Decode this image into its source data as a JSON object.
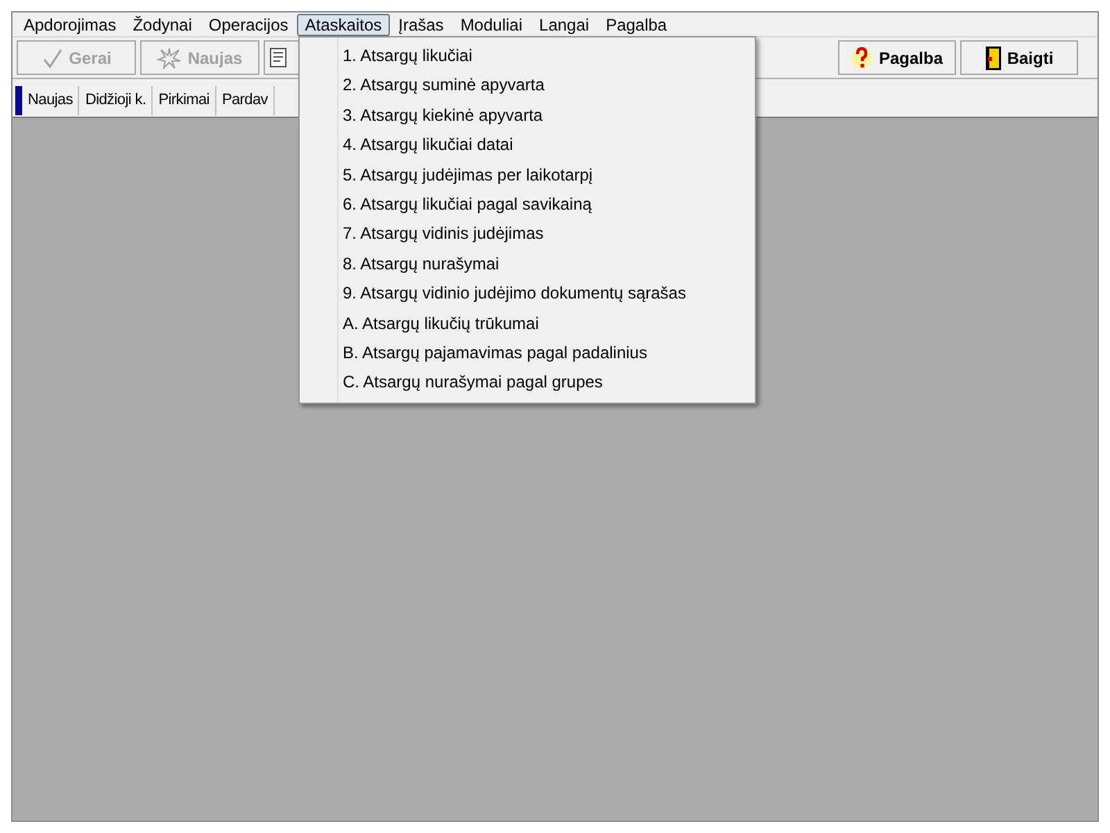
{
  "menu_bar": [
    {
      "label": "Apdorojimas",
      "selected": false
    },
    {
      "label": "Žodynai",
      "selected": false
    },
    {
      "label": "Operacijos",
      "selected": false
    },
    {
      "label": "Ataskaitos",
      "selected": true
    },
    {
      "label": "Įrašas",
      "selected": false
    },
    {
      "label": "Moduliai",
      "selected": false
    },
    {
      "label": "Langai",
      "selected": false
    },
    {
      "label": "Pagalba",
      "selected": false
    }
  ],
  "toolbar": [
    {
      "kind": "check",
      "label": "Gerai",
      "disabled": true
    },
    {
      "kind": "burst",
      "label": "Naujas",
      "disabled": true
    },
    {
      "kind": "document",
      "disabled": false
    },
    {
      "kind": "help",
      "label": "Pagalba",
      "disabled": false
    },
    {
      "kind": "door",
      "label": "Baigti",
      "disabled": false
    }
  ],
  "tabs": [
    {
      "label": "Naujas"
    },
    {
      "label": "Didžioji k."
    },
    {
      "label": "Pirkimai"
    },
    {
      "label": "Pardav"
    }
  ],
  "dropdown_menu": {
    "items": [
      "1. Atsargų likučiai",
      "2. Atsargų suminė apyvarta",
      "3. Atsargų kiekinė apyvarta",
      "4. Atsargų likučiai datai",
      "5. Atsargų judėjimas per laikotarpį",
      "6. Atsargų likučiai pagal savikainą",
      "7. Atsargų vidinis judėjimas",
      "8. Atsargų nurašymai",
      "9. Atsargų vidinio judėjimo dokumentų sąrašas",
      "A. Atsargų likučių trūkumai",
      "B. Atsargų pajamavimas pagal padalinius",
      "C. Atsargų nurašymai pagal grupes"
    ]
  }
}
